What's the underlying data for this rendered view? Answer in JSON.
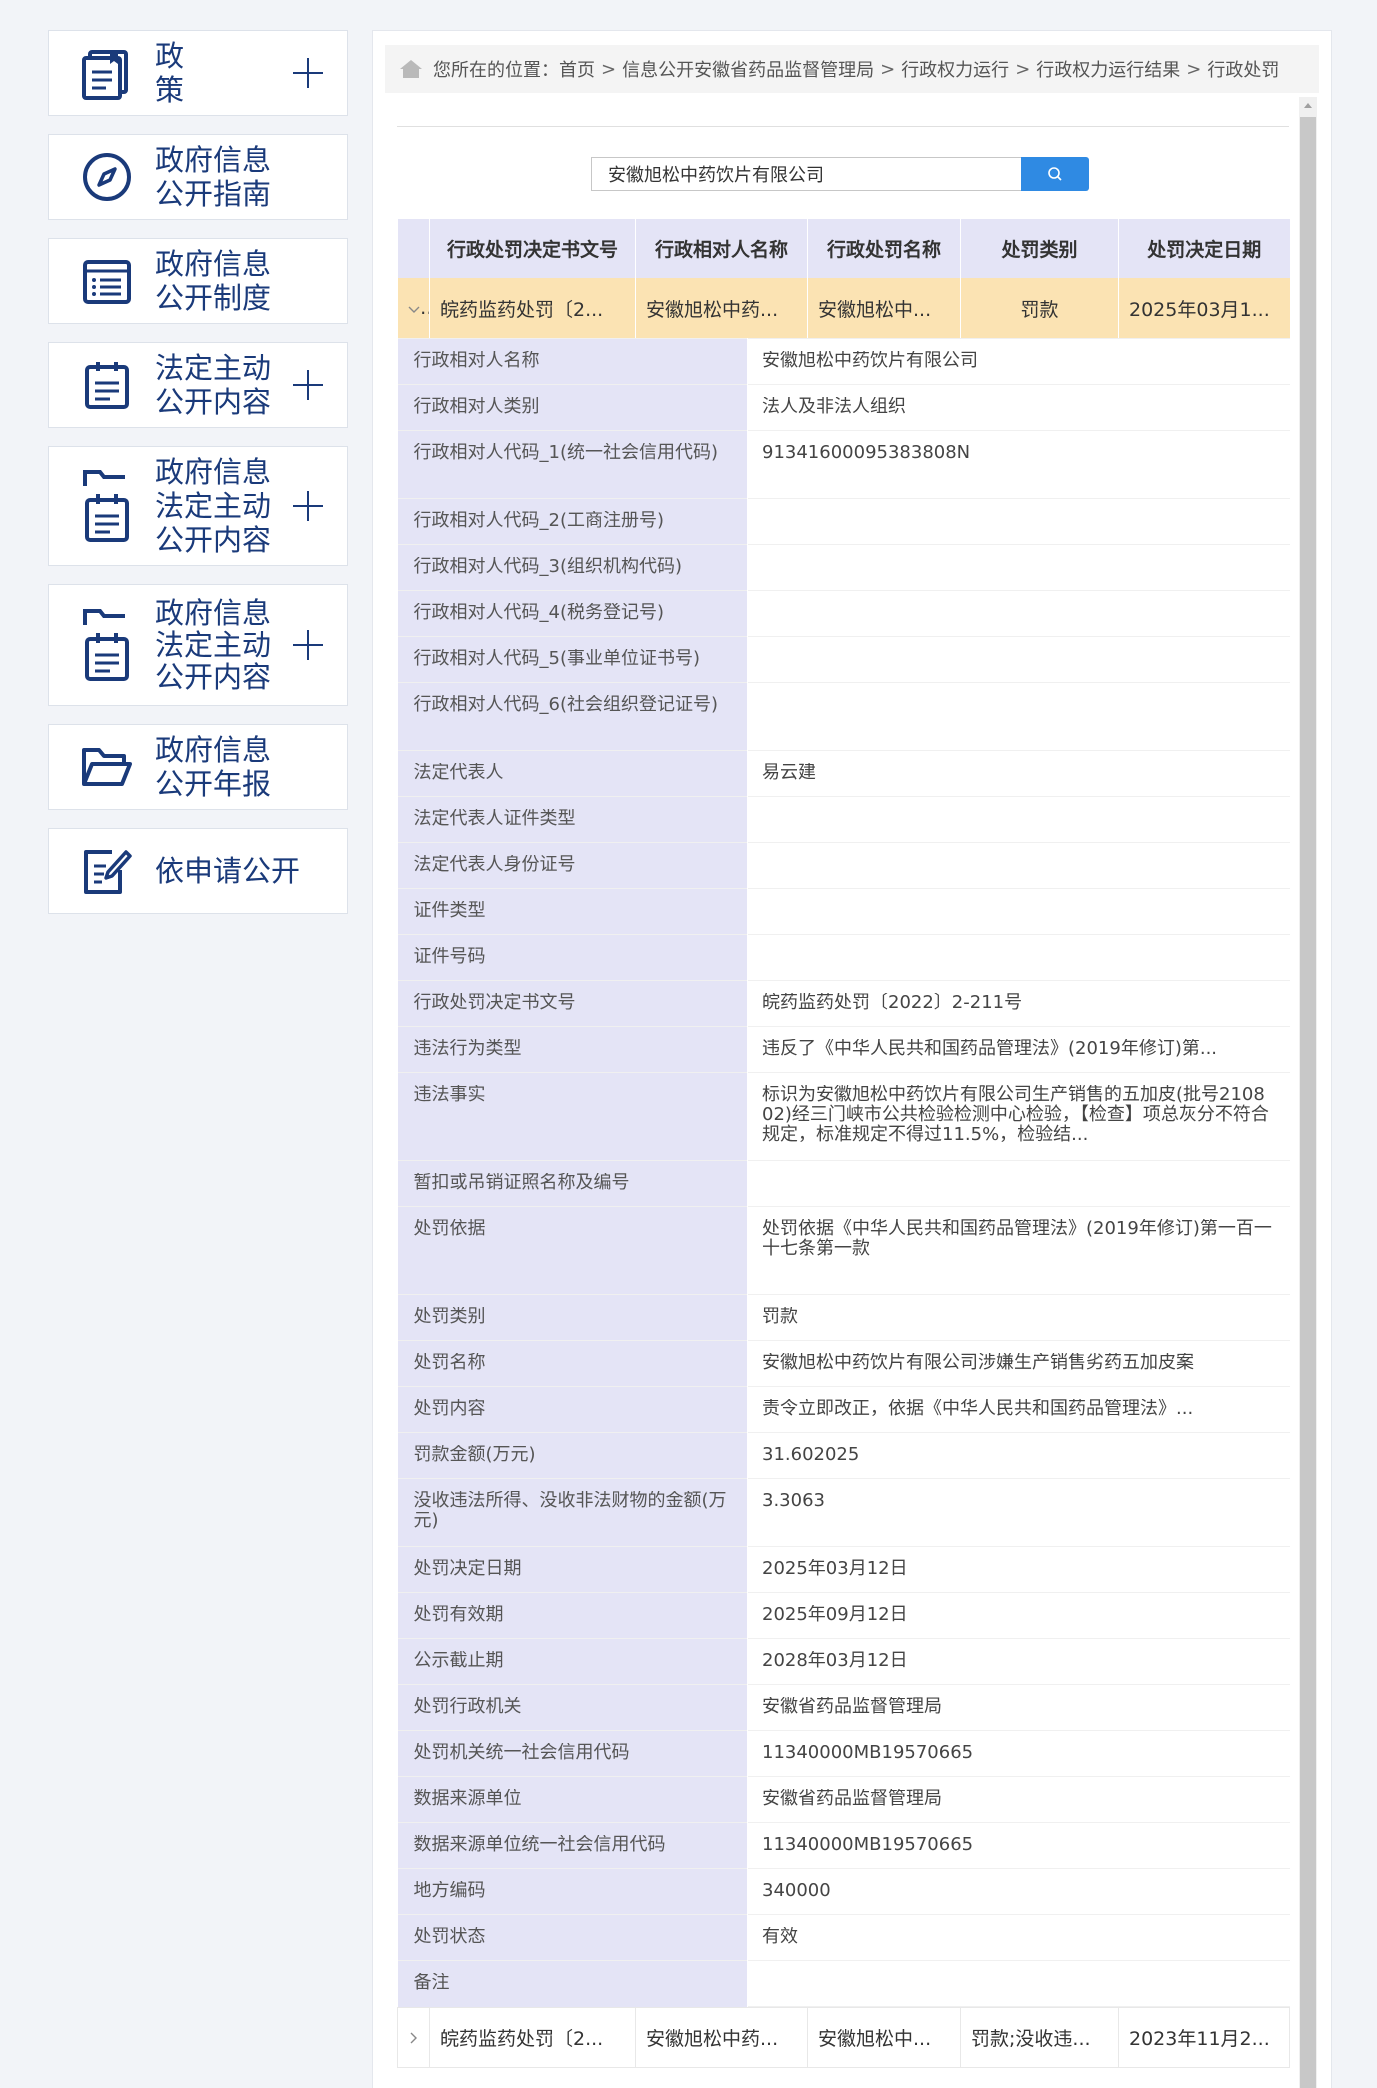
{
  "sidebar": {
    "items": [
      {
        "label": "政策",
        "icon": "book-icon",
        "expandable": true
      },
      {
        "label": "政府信息公开指南",
        "icon": "compass-icon",
        "expandable": false
      },
      {
        "label": "政府信息公开制度",
        "icon": "list-doc-icon",
        "expandable": false
      },
      {
        "label": "法定主动公开内容",
        "icon": "clipboard-icon",
        "expandable": true
      },
      {
        "label": "政府信息法定主动公开内容",
        "icon": "folder-clipboard-icon",
        "expandable": true
      },
      {
        "label": "政府信息法定主动公开内容",
        "icon": "folder-clipboard-icon",
        "expandable": true
      },
      {
        "label": "政府信息公开年报",
        "icon": "folder-open-icon",
        "expandable": false
      },
      {
        "label": "依申请公开",
        "icon": "edit-doc-icon",
        "expandable": false
      }
    ]
  },
  "breadcrumb": {
    "prefix": "您所在的位置：",
    "items": [
      "首页",
      "信息公开安徽省药品监督管理局",
      "行政权力运行",
      "行政权力运行结果",
      "行政处罚"
    ],
    "separator": ">"
  },
  "search": {
    "value": "安徽旭松中药饮片有限公司"
  },
  "table": {
    "headers": [
      "行政处罚决定书文号",
      "行政相对人名称",
      "行政处罚名称",
      "处罚类别",
      "处罚决定日期"
    ],
    "rows": [
      {
        "expanded": true,
        "cells": [
          "皖药监药处罚〔2...",
          "安徽旭松中药...",
          "安徽旭松中...",
          "罚款",
          "2025年03月1..."
        ]
      },
      {
        "expanded": false,
        "cells": [
          "皖药监药处罚〔2...",
          "安徽旭松中药...",
          "安徽旭松中...",
          "罚款;没收违...",
          "2023年11月2..."
        ]
      }
    ],
    "details": [
      {
        "key": "行政相对人名称",
        "value": "安徽旭松中药饮片有限公司"
      },
      {
        "key": "行政相对人类别",
        "value": "法人及非法人组织"
      },
      {
        "key": "行政相对人代码_1(统一社会信用代码)",
        "value": "91341600095383808N"
      },
      {
        "key": "行政相对人代码_2(工商注册号)",
        "value": ""
      },
      {
        "key": "行政相对人代码_3(组织机构代码)",
        "value": ""
      },
      {
        "key": "行政相对人代码_4(税务登记号)",
        "value": ""
      },
      {
        "key": "行政相对人代码_5(事业单位证书号)",
        "value": ""
      },
      {
        "key": "行政相对人代码_6(社会组织登记证号)",
        "value": ""
      },
      {
        "key": "法定代表人",
        "value": "易云建"
      },
      {
        "key": "法定代表人证件类型",
        "value": ""
      },
      {
        "key": "法定代表人身份证号",
        "value": ""
      },
      {
        "key": "证件类型",
        "value": ""
      },
      {
        "key": "证件号码",
        "value": ""
      },
      {
        "key": "行政处罚决定书文号",
        "value": "皖药监药处罚〔2022〕2-211号"
      },
      {
        "key": "违法行为类型",
        "value": "违反了《中华人民共和国药品管理法》(2019年修订)第..."
      },
      {
        "key": "违法事实",
        "value": "标识为安徽旭松中药饮片有限公司生产销售的五加皮(批号210802)经三门峡市公共检验检测中心检验，【检查】项总灰分不符合规定，标准规定不得过11.5%，检验结..."
      },
      {
        "key": "暂扣或吊销证照名称及编号",
        "value": ""
      },
      {
        "key": "处罚依据",
        "value": "处罚依据《中华人民共和国药品管理法》(2019年修订)第一百一十七条第一款"
      },
      {
        "key": "处罚类别",
        "value": "罚款"
      },
      {
        "key": "处罚名称",
        "value": "安徽旭松中药饮片有限公司涉嫌生产销售劣药五加皮案"
      },
      {
        "key": "处罚内容",
        "value": "责令立即改正，依据《中华人民共和国药品管理法》..."
      },
      {
        "key": "罚款金额(万元)",
        "value": "31.602025"
      },
      {
        "key": "没收违法所得、没收非法财物的金额(万元)",
        "value": "3.3063"
      },
      {
        "key": "处罚决定日期",
        "value": "2025年03月12日"
      },
      {
        "key": "处罚有效期",
        "value": "2025年09月12日"
      },
      {
        "key": "公示截止期",
        "value": "2028年03月12日"
      },
      {
        "key": "处罚行政机关",
        "value": "安徽省药品监督管理局"
      },
      {
        "key": "处罚机关统一社会信用代码",
        "value": "11340000MB19570665"
      },
      {
        "key": "数据来源单位",
        "value": "安徽省药品监督管理局"
      },
      {
        "key": "数据来源单位统一社会信用代码",
        "value": "11340000MB19570665"
      },
      {
        "key": "地方编码",
        "value": "340000"
      },
      {
        "key": "处罚状态",
        "value": "有效"
      },
      {
        "key": "备注",
        "value": ""
      }
    ]
  },
  "colors": {
    "accent": "#2f8ae3",
    "sidebar_text": "#1a3a7a",
    "header_bg": "#e4e4f6",
    "active_row_bg": "#fbe3b3"
  }
}
